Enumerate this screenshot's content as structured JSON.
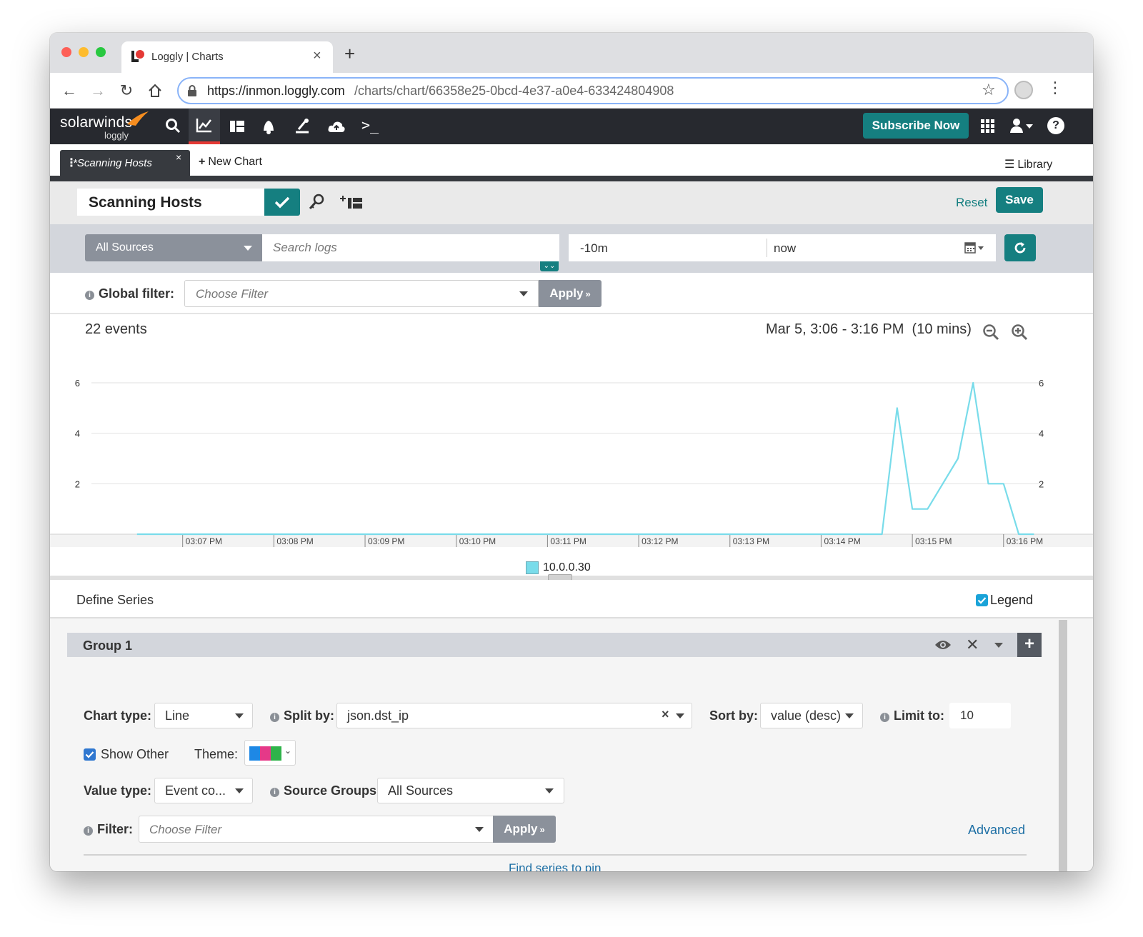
{
  "browser": {
    "tab_title": "Loggly | Charts",
    "url_domain": "https://inmon.loggly.com",
    "url_path": "/charts/chart/66358e25-0bcd-4e37-a0e4-633424804908"
  },
  "app": {
    "brand": "solarwinds",
    "brand_sub": "loggly",
    "subscribe_label": "Subscribe Now",
    "nav_icons": [
      "search-icon",
      "charts-icon",
      "dashboards-icon",
      "alerts-icon",
      "source-setup-icon",
      "cloud-icon",
      "terminal-icon"
    ]
  },
  "subtabs": {
    "active_tab": "*Scanning Hosts",
    "new_chart": "New Chart",
    "library": "Library"
  },
  "toolbar": {
    "chart_name": "Scanning Hosts",
    "reset": "Reset",
    "save": "Save"
  },
  "search": {
    "source_select": "All Sources",
    "search_placeholder": "Search logs",
    "time_from": "-10m",
    "time_to": "now"
  },
  "global_filter": {
    "label": "Global filter:",
    "placeholder": "Choose Filter",
    "apply": "Apply"
  },
  "chart_header": {
    "events": "22 events",
    "range": "Mar 5, 3:06 - 3:16 PM  (10 mins)"
  },
  "chart_data": {
    "type": "line",
    "ylim": [
      0,
      6
    ],
    "y_ticks": [
      2,
      4,
      6
    ],
    "x_ticks": [
      "03:07 PM",
      "03:08 PM",
      "03:09 PM",
      "03:10 PM",
      "03:11 PM",
      "03:12 PM",
      "03:13 PM",
      "03:14 PM",
      "03:15 PM",
      "03:16 PM"
    ],
    "series": [
      {
        "name": "10.0.0.30",
        "color": "#79dcea",
        "points": [
          {
            "t": "03:06:30 PM",
            "v": 0
          },
          {
            "t": "03:14:40 PM",
            "v": 0
          },
          {
            "t": "03:14:50 PM",
            "v": 5
          },
          {
            "t": "03:15:00 PM",
            "v": 1
          },
          {
            "t": "03:15:10 PM",
            "v": 1
          },
          {
            "t": "03:15:30 PM",
            "v": 3
          },
          {
            "t": "03:15:40 PM",
            "v": 6
          },
          {
            "t": "03:15:50 PM",
            "v": 2
          },
          {
            "t": "03:16:00 PM",
            "v": 2
          },
          {
            "t": "03:16:10 PM",
            "v": 0
          },
          {
            "t": "03:16:20 PM",
            "v": 0
          }
        ]
      }
    ],
    "grid": true,
    "legend": "bottom-center"
  },
  "define": {
    "title": "Define Series",
    "legend_label": "Legend",
    "group": "Group 1",
    "chart_type_label": "Chart type:",
    "chart_type": "Line",
    "split_by_label": "Split by:",
    "split_by": "json.dst_ip",
    "sort_by_label": "Sort by:",
    "sort_by": "value (desc)",
    "limit_label": "Limit to:",
    "limit": "10",
    "show_other": "Show Other",
    "theme_label": "Theme:",
    "theme_colors": [
      "#1e88e5",
      "#e53988",
      "#2fb34a"
    ],
    "value_type_label": "Value type:",
    "value_type": "Event co...",
    "source_groups_label": "Source Groups",
    "source_groups": "All Sources",
    "filter_label": "Filter:",
    "filter_placeholder": "Choose Filter",
    "apply": "Apply",
    "advanced": "Advanced",
    "find_series": "Find series to pin"
  }
}
